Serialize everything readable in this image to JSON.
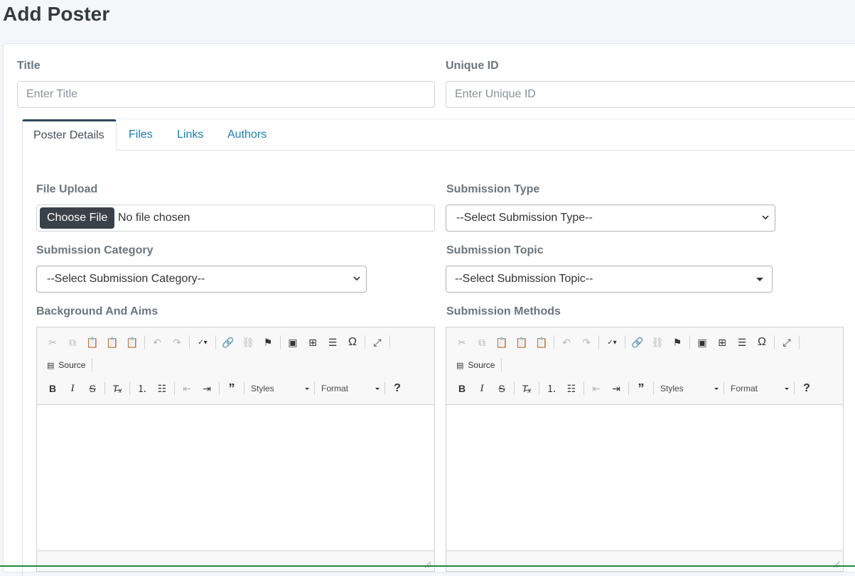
{
  "page": {
    "title": "Add Poster"
  },
  "form": {
    "title_label": "Title",
    "title_placeholder": "Enter Title",
    "uid_label": "Unique ID",
    "uid_placeholder": "Enter Unique ID"
  },
  "tabs": [
    {
      "label": "Poster Details",
      "active": true
    },
    {
      "label": "Files"
    },
    {
      "label": "Links"
    },
    {
      "label": "Authors"
    }
  ],
  "details": {
    "file_upload_label": "File Upload",
    "file_button": "Choose File",
    "file_status": "No file chosen",
    "submission_type_label": "Submission Type",
    "submission_type_value": "--Select Submission Type--",
    "submission_category_label": "Submission Category",
    "submission_category_value": "--Select Submission Category--",
    "submission_topic_label": "Submission Topic",
    "submission_topic_value": "--Select Submission Topic--",
    "background_label": "Background And Aims",
    "methods_label": "Submission Methods"
  },
  "editor": {
    "source_label": "Source",
    "styles_label": "Styles",
    "format_label": "Format",
    "icons": [
      "cut-icon",
      "copy-icon",
      "paste-icon",
      "paste-text-icon",
      "paste-word-icon",
      "undo-icon",
      "redo-icon",
      "spellcheck-icon",
      "link-icon",
      "unlink-icon",
      "anchor-icon",
      "image-icon",
      "table-icon",
      "horizontal-rule-icon",
      "special-char-icon",
      "maximize-icon",
      "source-icon",
      "bold-icon",
      "italic-icon",
      "strike-icon",
      "remove-format-icon",
      "numbered-list-icon",
      "bulleted-list-icon",
      "outdent-icon",
      "indent-icon",
      "blockquote-icon",
      "help-icon"
    ]
  },
  "colors": {
    "tab_link": "#1a7fb5",
    "file_button": "#3b4148",
    "label": "#6c757d"
  }
}
